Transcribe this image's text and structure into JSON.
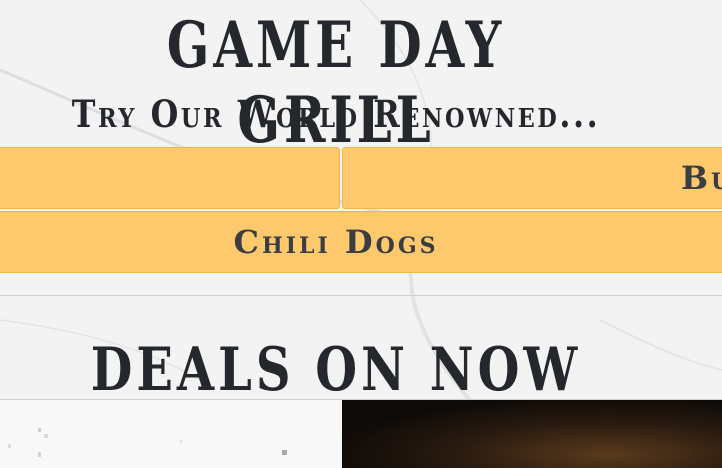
{
  "header": {
    "title": "GAME DAY GRILL",
    "subtitle": "Try Our World Renowned..."
  },
  "menu": {
    "items": [
      {
        "label": ""
      },
      {
        "label": "Bur"
      },
      {
        "label": "Chili Dogs"
      }
    ]
  },
  "deals": {
    "title": "DEALS ON NOW"
  },
  "colors": {
    "tile": "#fdc96c",
    "heading": "#24272c",
    "background": "#f3f3f3"
  }
}
